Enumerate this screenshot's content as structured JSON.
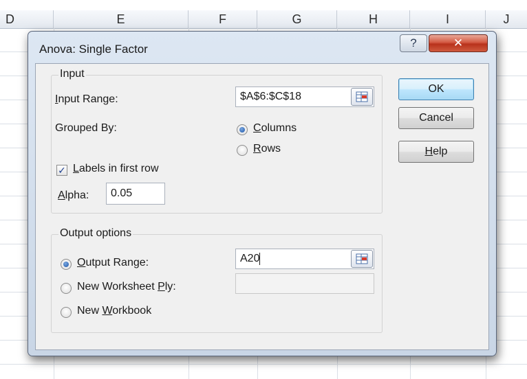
{
  "spreadsheet": {
    "column_headers": [
      "D",
      "E",
      "F",
      "G",
      "H",
      "I",
      "J"
    ]
  },
  "dialog": {
    "title": "Anova: Single Factor",
    "help_glyph": "?",
    "close_glyph": "✕",
    "input_group": {
      "label": "Input",
      "input_range_label": "Input Range:",
      "input_range_value": "$A$6:$C$18",
      "grouped_by_label": "Grouped By:",
      "grouped_by_options": [
        "Columns",
        "Rows"
      ],
      "grouped_by_selected": "Columns",
      "labels_checkbox_label": "Labels in first row",
      "labels_checked": true,
      "alpha_label": "Alpha:",
      "alpha_value": "0.05"
    },
    "output_group": {
      "label": "Output options",
      "options": [
        "Output Range:",
        "New Worksheet Ply:",
        "New Workbook"
      ],
      "selected": "Output Range:",
      "output_range_value": "A20",
      "new_worksheet_value": ""
    },
    "buttons": {
      "ok": "OK",
      "cancel": "Cancel",
      "help": "Help"
    }
  }
}
